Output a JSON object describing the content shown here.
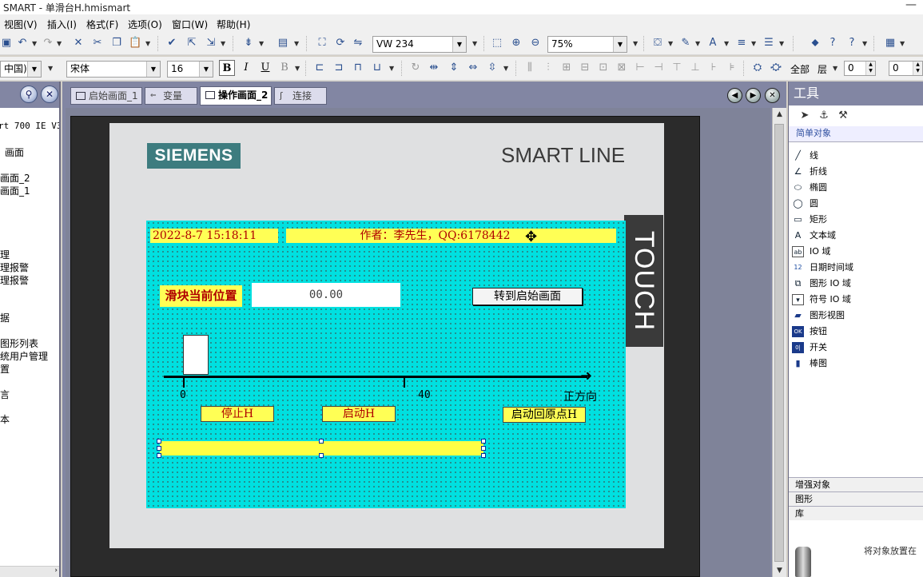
{
  "window": {
    "title": "SMART - 单滑台H.hmismart",
    "minimize": "—"
  },
  "menu": [
    "视图(V)",
    "插入(I)",
    "格式(F)",
    "选项(O)",
    "窗口(W)",
    "帮助(H)"
  ],
  "toolbar1": {
    "tag_combo": "VW 234",
    "zoom_combo": "75%"
  },
  "toolbar2": {
    "lang_combo": "中国)",
    "font_combo": "宋体",
    "size_combo": "16",
    "bold": "B",
    "italic": "I",
    "underline": "U",
    "strike": "B",
    "layer_all": "全部",
    "layer_label": "层",
    "spin1": "0",
    "spin2": "0"
  },
  "project_tree": {
    "items": [
      "rt 700 IE V3)",
      "画面",
      "画面_2",
      "画面_1",
      "理",
      "理报警",
      "理报警",
      "据",
      "图形列表",
      "统用户管理",
      "置",
      "言",
      "本"
    ]
  },
  "tabs": [
    {
      "label": "启始画面_1"
    },
    {
      "label": "变量"
    },
    {
      "label": "操作画面_2"
    },
    {
      "label": "连接"
    }
  ],
  "panel": {
    "brand": "SIEMENS",
    "model": "SMART LINE",
    "touch": "TOUCH"
  },
  "hmi": {
    "datetime": "2022-8-7 15:18:11",
    "author": "作者：李先生，QQ:6178442",
    "pos_label": "滑块当前位置",
    "pos_value": "00.00",
    "goto_button": "转到启始画面",
    "tick0": "0",
    "tick1": "40",
    "direction": "正方向",
    "stop_button": "停止H",
    "start_button": "启动H",
    "home_button": "启动回原点H"
  },
  "tools": {
    "title": "工具",
    "simple_header": "简单对象",
    "items": [
      {
        "icon": "line-icon",
        "glyph": "╱",
        "label": "线"
      },
      {
        "icon": "polyline-icon",
        "glyph": "∠",
        "label": "折线"
      },
      {
        "icon": "ellipse-icon",
        "glyph": "⬭",
        "label": "椭圆"
      },
      {
        "icon": "circle-icon",
        "glyph": "◯",
        "label": "圆"
      },
      {
        "icon": "rectangle-icon",
        "glyph": "▭",
        "label": "矩形"
      },
      {
        "icon": "text-icon",
        "glyph": "A",
        "label": "文本域"
      },
      {
        "icon": "io-field-icon",
        "glyph": "ab",
        "label": "IO 域"
      },
      {
        "icon": "datetime-icon",
        "glyph": "12",
        "label": "日期时间域"
      },
      {
        "icon": "graphic-io-icon",
        "glyph": "⧉",
        "label": "图形 IO 域"
      },
      {
        "icon": "symbolic-io-icon",
        "glyph": "▾",
        "label": "符号 IO 域"
      },
      {
        "icon": "graphic-view-icon",
        "glyph": "▰",
        "label": "图形视图"
      },
      {
        "icon": "button-icon",
        "glyph": "OK",
        "label": "按钮"
      },
      {
        "icon": "switch-icon",
        "glyph": "0|",
        "label": "开关"
      },
      {
        "icon": "bar-icon",
        "glyph": "▮",
        "label": "棒图"
      }
    ],
    "enhanced": "增强对象",
    "graphics": "图形",
    "library": "库",
    "library_hint": "将对象放置在"
  }
}
